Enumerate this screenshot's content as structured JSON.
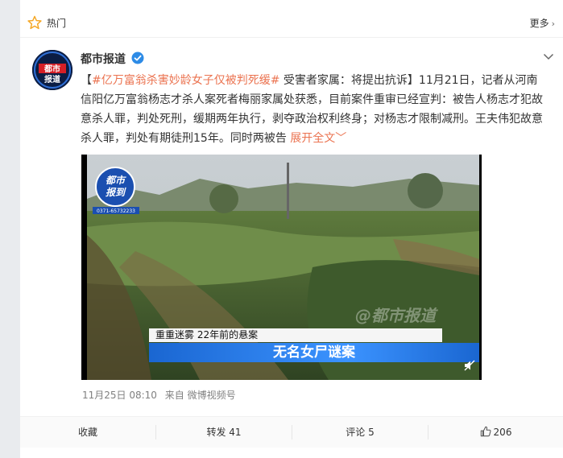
{
  "header": {
    "label": "热门",
    "more": "更多",
    "icon": "star-outline-icon"
  },
  "post": {
    "author": "都市报道",
    "topic": "#亿万富翁杀害妙龄女子仅被判死缓#",
    "text_after_topic": " 受害者家属：将提出抗诉】11月21日，记者从河南信阳亿万富翁杨志才杀人案死者梅丽家属处获悉，目前案件重审已经宣判：被告人杨志才犯故意杀人罪，判处死刑，缓期两年执行，剥夺政治权利终身；对杨志才限制减刑。王夫伟犯故意杀人罪，判处有期徒刑15年。同时两被告",
    "bracket_open": "【",
    "expand": "展开全文",
    "timestamp": "11月25日 08:10",
    "source": "来自 微博视频号"
  },
  "video": {
    "badge_line1": "都市",
    "badge_line2": "报到",
    "badge_phone": "0371-65732233",
    "watermark": "@都市报道",
    "subtitle_top": "重重迷雾  22年前的悬案",
    "subtitle_main": "无名女尸谜案"
  },
  "avatar": {
    "line1": "都市",
    "line2": "报道"
  },
  "actions": {
    "favorite": "收藏",
    "repost": "转发 41",
    "comment": "评论 5",
    "like": "206"
  },
  "colors": {
    "accent": "#eb7350",
    "link": "#eb7350",
    "subtitle_bg": "#2a7ef0"
  }
}
